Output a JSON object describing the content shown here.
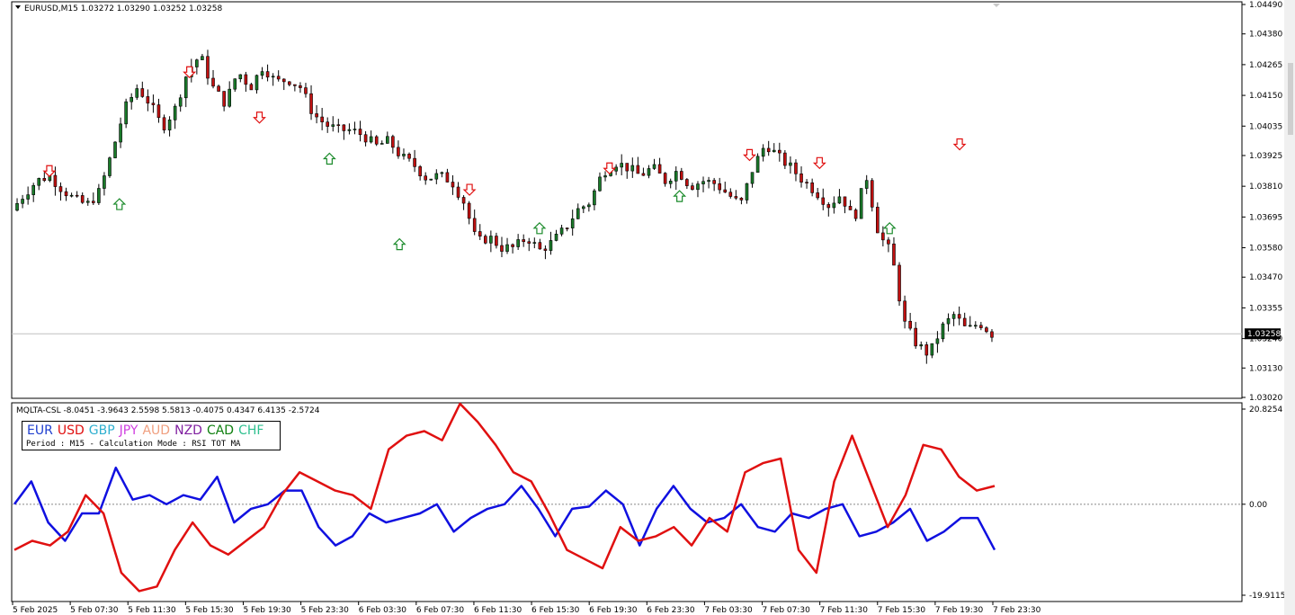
{
  "main_header": {
    "symbol_tf": "EURUSD,M15",
    "ohlc": "1.03272 1.03290 1.03252 1.03258"
  },
  "indicator_header": "MQLTA-CSL -8.0451 -3.9643 2.5598 5.5813 -0.4075 0.4347 6.4135 -2.5724",
  "legend": {
    "currencies": [
      {
        "name": "EUR",
        "color": "#1f3fcf"
      },
      {
        "name": "USD",
        "color": "#e01010"
      },
      {
        "name": "GBP",
        "color": "#30b0d0"
      },
      {
        "name": "JPY",
        "color": "#d040e0"
      },
      {
        "name": "AUD",
        "color": "#f0a080"
      },
      {
        "name": "NZD",
        "color": "#8020a0"
      },
      {
        "name": "CAD",
        "color": "#108010"
      },
      {
        "name": "CHF",
        "color": "#30c090"
      }
    ],
    "subtitle": "Period : M15 - Calculation Mode : RSI TOT MA"
  },
  "chart_data": [
    {
      "type": "candlestick",
      "symbol": "EURUSD",
      "timeframe": "M15",
      "ylim": [
        1.0302,
        1.0449
      ],
      "y_ticks": [
        "1.04490",
        "1.04380",
        "1.04265",
        "1.04150",
        "1.04035",
        "1.03925",
        "1.03810",
        "1.03695",
        "1.03580",
        "1.03470",
        "1.03355",
        "1.03240",
        "1.03130",
        "1.03020"
      ],
      "last_price": "1.03258",
      "close_series": [
        1.0372,
        1.0378,
        1.0383,
        1.0385,
        1.038,
        1.0376,
        1.0374,
        1.0379,
        1.0394,
        1.041,
        1.0418,
        1.0412,
        1.0403,
        1.041,
        1.0424,
        1.043,
        1.0418,
        1.0412,
        1.0424,
        1.0418,
        1.0426,
        1.042,
        1.0421,
        1.0418,
        1.0408,
        1.0404,
        1.0402,
        1.0402,
        1.04,
        1.0396,
        1.0398,
        1.0392,
        1.0389,
        1.0384,
        1.0385,
        1.0383,
        1.0375,
        1.036,
        1.0362,
        1.0358,
        1.0358,
        1.0362,
        1.0357,
        1.036,
        1.0365,
        1.0372,
        1.0375,
        1.0386,
        1.039,
        1.0388,
        1.0385,
        1.0388,
        1.0383,
        1.0387,
        1.0381,
        1.0383,
        1.0382,
        1.0378,
        1.0374,
        1.0388,
        1.0397,
        1.0392,
        1.0388,
        1.0383,
        1.0379,
        1.0374,
        1.0378,
        1.0368,
        1.0385,
        1.0363,
        1.0356,
        1.033,
        1.0322,
        1.0318,
        1.0328,
        1.0333,
        1.0327,
        1.033,
        1.03258
      ],
      "signals": [
        {
          "type": "sell",
          "price": 1.0384
        },
        {
          "type": "buy",
          "price": 1.0377
        },
        {
          "type": "sell",
          "price": 1.0421
        },
        {
          "type": "sell",
          "price": 1.0404
        },
        {
          "type": "buy",
          "price": 1.0394
        },
        {
          "type": "buy",
          "price": 1.0362
        },
        {
          "type": "sell",
          "price": 1.0377
        },
        {
          "type": "buy",
          "price": 1.0368
        },
        {
          "type": "sell",
          "price": 1.0385
        },
        {
          "type": "buy",
          "price": 1.038
        },
        {
          "type": "sell",
          "price": 1.039
        },
        {
          "type": "sell",
          "price": 1.0387
        },
        {
          "type": "buy",
          "price": 1.0368
        },
        {
          "type": "sell",
          "price": 1.0394
        }
      ]
    },
    {
      "type": "line",
      "title": "MQLTA-CSL",
      "ylim": [
        -19.9115,
        20.8254
      ],
      "y_ticks": [
        "20.8254",
        "0.00",
        "-19.9115"
      ],
      "zero_line": true,
      "x_ticks": [
        "5 Feb 2025",
        "5 Feb 07:30",
        "5 Feb 11:30",
        "5 Feb 15:30",
        "5 Feb 19:30",
        "5 Feb 23:30",
        "6 Feb 03:30",
        "6 Feb 07:30",
        "6 Feb 11:30",
        "6 Feb 15:30",
        "6 Feb 19:30",
        "6 Feb 23:30",
        "7 Feb 03:30",
        "7 Feb 07:30",
        "7 Feb 11:30",
        "7 Feb 15:30",
        "7 Feb 19:30",
        "7 Feb 23:30"
      ],
      "series": [
        {
          "name": "EUR",
          "color": "#1010e0",
          "values": [
            0,
            5,
            -4,
            -8,
            -2,
            -2,
            8,
            1,
            2,
            0,
            2,
            1,
            6,
            -4,
            -1,
            0,
            3,
            3,
            -5,
            -9,
            -7,
            -2,
            -4,
            -3,
            -2,
            0,
            -6,
            -3,
            -1,
            0,
            4,
            -1,
            -7,
            -1,
            -0.5,
            3,
            0,
            -9,
            -1,
            4,
            -1,
            -4,
            -3,
            0,
            -5,
            -6,
            -2,
            -3,
            -1,
            0,
            -7,
            -6,
            -4,
            -1,
            -8,
            -6,
            -3,
            -3,
            -10
          ]
        },
        {
          "name": "USD",
          "color": "#e01010",
          "values": [
            -10,
            -8,
            -9,
            -6,
            2,
            -2,
            -15,
            -19,
            -18,
            -10,
            -4,
            -9,
            -11,
            -8,
            -5,
            2,
            7,
            5,
            3,
            2,
            -1,
            12,
            15,
            16,
            14,
            22,
            18,
            13,
            7,
            5,
            -2,
            -10,
            -12,
            -14,
            -5,
            -8,
            -7,
            -5,
            -9,
            -3,
            -6,
            7,
            9,
            10,
            -10,
            -15,
            5,
            15,
            5,
            -5,
            2,
            13,
            12,
            6,
            3,
            4
          ]
        }
      ]
    }
  ]
}
